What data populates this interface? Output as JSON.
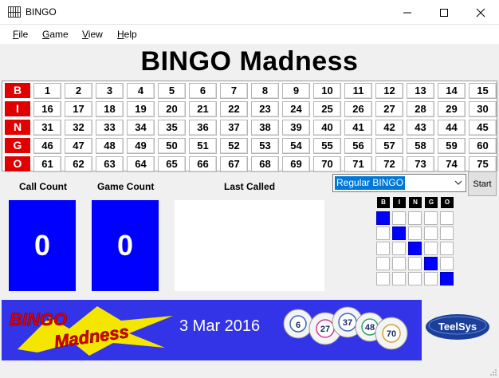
{
  "window": {
    "title": "BINGO"
  },
  "menu": [
    {
      "label": "File",
      "accel": "F",
      "rest": "ile"
    },
    {
      "label": "Game",
      "accel": "G",
      "rest": "ame"
    },
    {
      "label": "View",
      "accel": "V",
      "rest": "iew"
    },
    {
      "label": "Help",
      "accel": "H",
      "rest": "elp"
    }
  ],
  "heading": "BINGO Madness",
  "board": {
    "letters": [
      "B",
      "I",
      "N",
      "G",
      "O"
    ],
    "rows": [
      [
        "1",
        "2",
        "3",
        "4",
        "5",
        "6",
        "7",
        "8",
        "9",
        "10",
        "11",
        "12",
        "13",
        "14",
        "15"
      ],
      [
        "16",
        "17",
        "18",
        "19",
        "20",
        "21",
        "22",
        "23",
        "24",
        "25",
        "26",
        "27",
        "28",
        "29",
        "30"
      ],
      [
        "31",
        "32",
        "33",
        "34",
        "35",
        "36",
        "37",
        "38",
        "39",
        "40",
        "41",
        "42",
        "43",
        "44",
        "45"
      ],
      [
        "46",
        "47",
        "48",
        "49",
        "50",
        "51",
        "52",
        "53",
        "54",
        "55",
        "56",
        "57",
        "58",
        "59",
        "60"
      ],
      [
        "61",
        "62",
        "63",
        "64",
        "65",
        "66",
        "67",
        "68",
        "69",
        "70",
        "71",
        "72",
        "73",
        "74",
        "75"
      ]
    ]
  },
  "counters": {
    "call_count_label": "Call Count",
    "call_count_value": "0",
    "game_count_label": "Game Count",
    "game_count_value": "0",
    "last_called_label": "Last Called",
    "last_called_value": ""
  },
  "game_type": {
    "selected": "Regular BINGO"
  },
  "start_label": "Start",
  "pattern": {
    "headers": [
      "B",
      "I",
      "N",
      "G",
      "O"
    ],
    "marked": [
      [
        true,
        false,
        false,
        false,
        false
      ],
      [
        false,
        true,
        false,
        false,
        false
      ],
      [
        false,
        false,
        true,
        false,
        false
      ],
      [
        false,
        false,
        false,
        true,
        false
      ],
      [
        false,
        false,
        false,
        false,
        true
      ]
    ]
  },
  "banner": {
    "logo_line1": "BINGO",
    "logo_line2": "Madness",
    "date": "3 Mar 2016",
    "balls": [
      "6",
      "27",
      "37",
      "48",
      "70"
    ]
  },
  "teelsys_logo": "TeelSys",
  "colors": {
    "letter_bg": "#e00000",
    "count_bg": "#0000ff",
    "banner_bg": "#3333e8",
    "selection": "#0078d7"
  }
}
